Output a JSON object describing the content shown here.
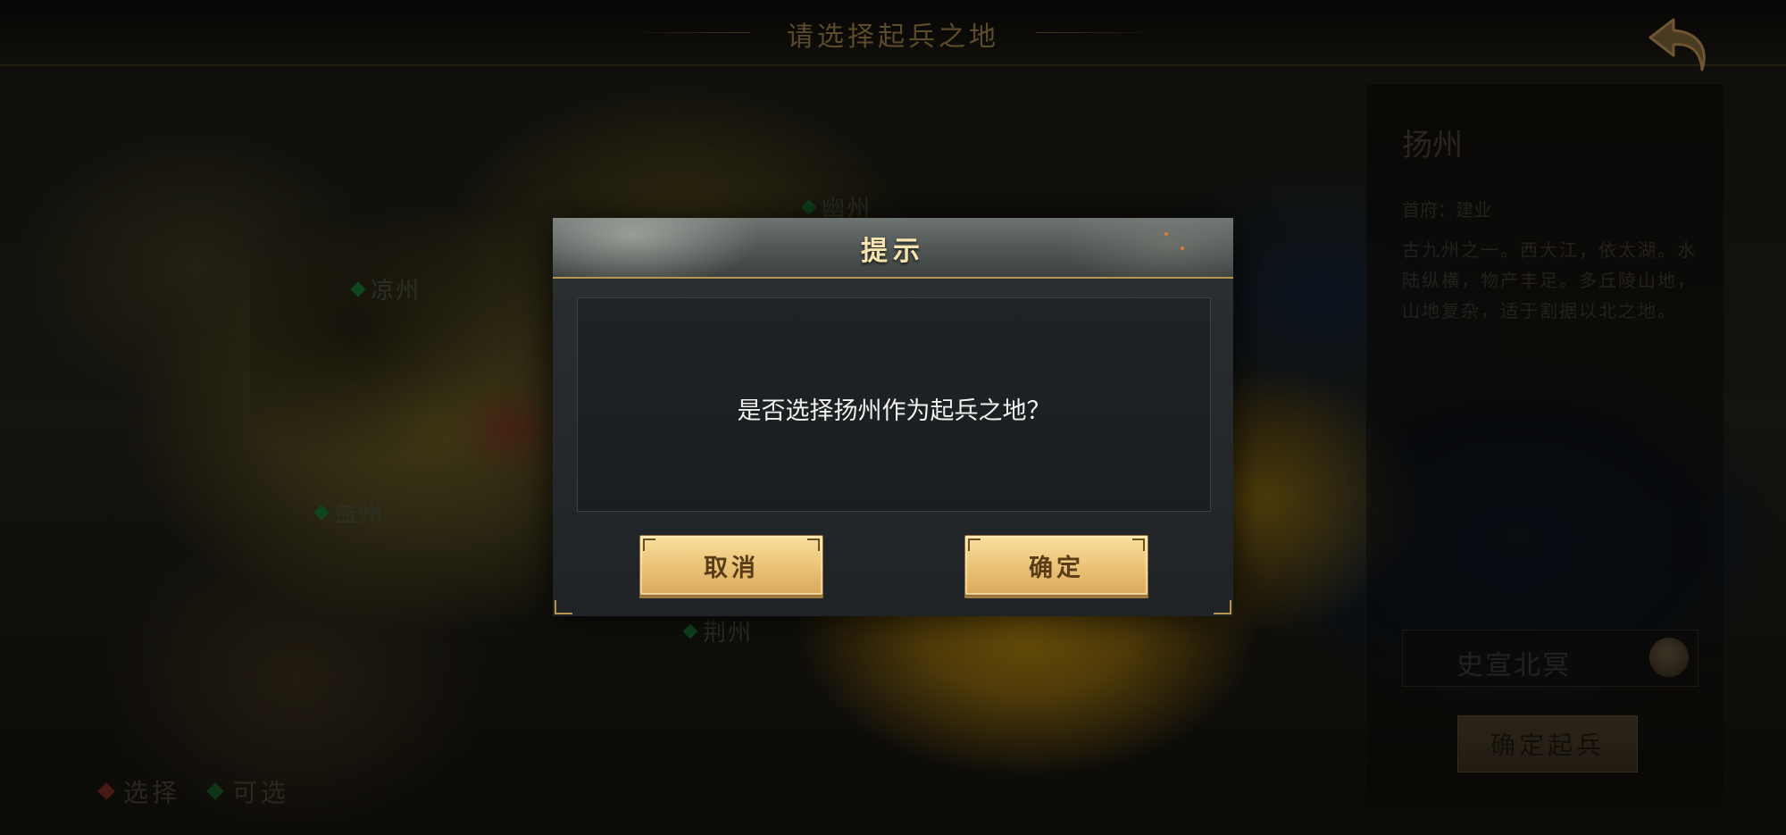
{
  "top_bar": {
    "title": "请选择起兵之地",
    "back_icon": "back-arrow-icon"
  },
  "map": {
    "labels": [
      {
        "name": "幽州",
        "status": "available"
      },
      {
        "name": "凉州",
        "status": "available"
      },
      {
        "name": "益州",
        "status": "available"
      },
      {
        "name": "荆州",
        "status": "available"
      }
    ]
  },
  "legend": {
    "items": [
      {
        "label": "选择",
        "color": "#c0392b"
      },
      {
        "label": "可选",
        "color": "#1f8a3e"
      }
    ]
  },
  "info_panel": {
    "region_name": "扬州",
    "capital": "首府：建业",
    "description": "古九州之一。西大江，依太湖。水陆纵横，物产丰足。多丘陵山地，山地复杂，适于割据以北之地。",
    "general_name": "史宣北冥",
    "action_label": "确定起兵"
  },
  "dialog": {
    "title": "提示",
    "message": "是否选择扬州作为起兵之地？",
    "cancel_label": "取消",
    "confirm_label": "确定"
  },
  "colors": {
    "accent_gold": "#b7944f",
    "button_gold": "#edc77c",
    "button_text": "#5a3c18",
    "dialog_bg": "#24282b"
  }
}
